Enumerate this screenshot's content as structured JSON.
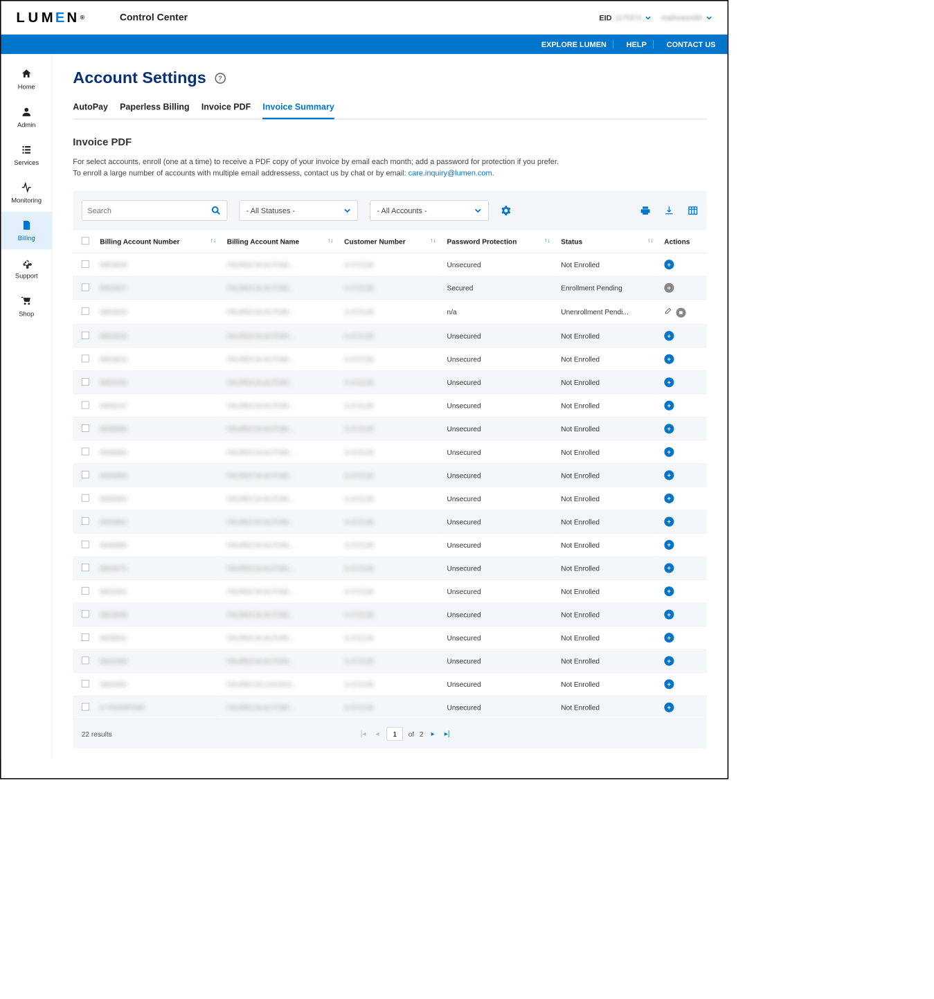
{
  "header": {
    "logo": "LUMEN",
    "app": "Control Center",
    "eid_label": "EID",
    "eid_value": "1170372",
    "username": "mathewsmith"
  },
  "bluebar": {
    "explore": "EXPLORE LUMEN",
    "help": "HELP",
    "contact": "CONTACT US"
  },
  "sidebar": {
    "items": [
      {
        "label": "Home"
      },
      {
        "label": "Admin"
      },
      {
        "label": "Services"
      },
      {
        "label": "Monitoring"
      },
      {
        "label": "Billing"
      },
      {
        "label": "Support"
      },
      {
        "label": "Shop"
      }
    ]
  },
  "page": {
    "title": "Account Settings",
    "tabs": [
      {
        "label": "AutoPay"
      },
      {
        "label": "Paperless Billing"
      },
      {
        "label": "Invoice PDF"
      },
      {
        "label": "Invoice Summary"
      }
    ],
    "section_title": "Invoice PDF",
    "desc_line1": "For select accounts, enroll (one at a time) to receive a PDF copy of your invoice by email each month; add a password for protection if you prefer.",
    "desc_line2a": "To enroll a large number of accounts with multiple email addressess, contact us by chat or by email: ",
    "desc_email": "care.inquiry@lumen.com",
    "desc_period": "."
  },
  "toolbar": {
    "search_placeholder": "Search",
    "status_filter": "- All Statuses -",
    "account_filter": "- All Accounts -"
  },
  "table": {
    "headers": {
      "ban": "Billing Account Number",
      "name": "Billing Account Name",
      "cust": "Customer Number",
      "pwd": "Password Protection",
      "status": "Status",
      "actions": "Actions"
    },
    "rows": [
      {
        "ban": "8953928",
        "name": "FAURECIA AUTOM...",
        "cust": "3-472135",
        "pwd": "Unsecured",
        "status": "Not Enrolled",
        "action": "add"
      },
      {
        "ban": "8953927",
        "name": "FAURECIA AUTOM...",
        "cust": "3-472135",
        "pwd": "Secured",
        "status": "Enrollment Pending",
        "action": "grey"
      },
      {
        "ban": "8953926",
        "name": "FAURECIA AUTOM...",
        "cust": "3-472135",
        "pwd": "n/a",
        "status": "Unenrollment Pendi...",
        "action": "edit"
      },
      {
        "ban": "8953925",
        "name": "FAURECIA AUTOM...",
        "cust": "3-472135",
        "pwd": "Unsecured",
        "status": "Not Enrolled",
        "action": "add"
      },
      {
        "ban": "8953924",
        "name": "FAURECIA AUTOM...",
        "cust": "3-472135",
        "pwd": "Unsecured",
        "status": "Not Enrolled",
        "action": "add"
      },
      {
        "ban": "8953206",
        "name": "FAURECIA AUTOM...",
        "cust": "3-472135",
        "pwd": "Unsecured",
        "status": "Not Enrolled",
        "action": "add"
      },
      {
        "ban": "8949147",
        "name": "FAURECIA AUTOM...",
        "cust": "3-472135",
        "pwd": "Unsecured",
        "status": "Not Enrolled",
        "action": "add"
      },
      {
        "ban": "8935885",
        "name": "FAURECIA AUTOM...",
        "cust": "3-472135",
        "pwd": "Unsecured",
        "status": "Not Enrolled",
        "action": "add"
      },
      {
        "ban": "8935884",
        "name": "FAURECIA AUTOM...",
        "cust": "3-472135",
        "pwd": "Unsecured",
        "status": "Not Enrolled",
        "action": "add"
      },
      {
        "ban": "8935883",
        "name": "FAURECIA AUTOM...",
        "cust": "3-472135",
        "pwd": "Unsecured",
        "status": "Not Enrolled",
        "action": "add"
      },
      {
        "ban": "8935882",
        "name": "FAURECIA AUTOM...",
        "cust": "3-472135",
        "pwd": "Unsecured",
        "status": "Not Enrolled",
        "action": "add"
      },
      {
        "ban": "8935881",
        "name": "FAURECIA AUTOM...",
        "cust": "3-472135",
        "pwd": "Unsecured",
        "status": "Not Enrolled",
        "action": "add"
      },
      {
        "ban": "8935880",
        "name": "FAURECIA AUTOM...",
        "cust": "3-472135",
        "pwd": "Unsecured",
        "status": "Not Enrolled",
        "action": "add"
      },
      {
        "ban": "8933075",
        "name": "FAURECIA AUTOM...",
        "cust": "3-472135",
        "pwd": "Unsecured",
        "status": "Not Enrolled",
        "action": "add"
      },
      {
        "ban": "8931961",
        "name": "FAURECIA AUTOM...",
        "cust": "3-472135",
        "pwd": "Unsecured",
        "status": "Not Enrolled",
        "action": "add"
      },
      {
        "ban": "8916938",
        "name": "FAURECIA AUTOM...",
        "cust": "3-472135",
        "pwd": "Unsecured",
        "status": "Not Enrolled",
        "action": "add"
      },
      {
        "ban": "8839591",
        "name": "FAURECIA AUTOM...",
        "cust": "3-472135",
        "pwd": "Unsecured",
        "status": "Not Enrolled",
        "action": "add"
      },
      {
        "ban": "8846369",
        "name": "FAURECIA AUTOM...",
        "cust": "3-472135",
        "pwd": "Unsecured",
        "status": "Not Enrolled",
        "action": "add"
      },
      {
        "ban": "5820492",
        "name": "FAURECIA LOUISVI...",
        "cust": "3-472135",
        "pwd": "Unsecured",
        "status": "Not Enrolled",
        "action": "add"
      },
      {
        "ban": "5-YRONP0M5",
        "name": "FAURECIA AUTOM...",
        "cust": "3-472135",
        "pwd": "Unsecured",
        "status": "Not Enrolled",
        "action": "add"
      }
    ]
  },
  "footer": {
    "results": "22 results",
    "page": "1",
    "of": "of",
    "total": "2"
  }
}
